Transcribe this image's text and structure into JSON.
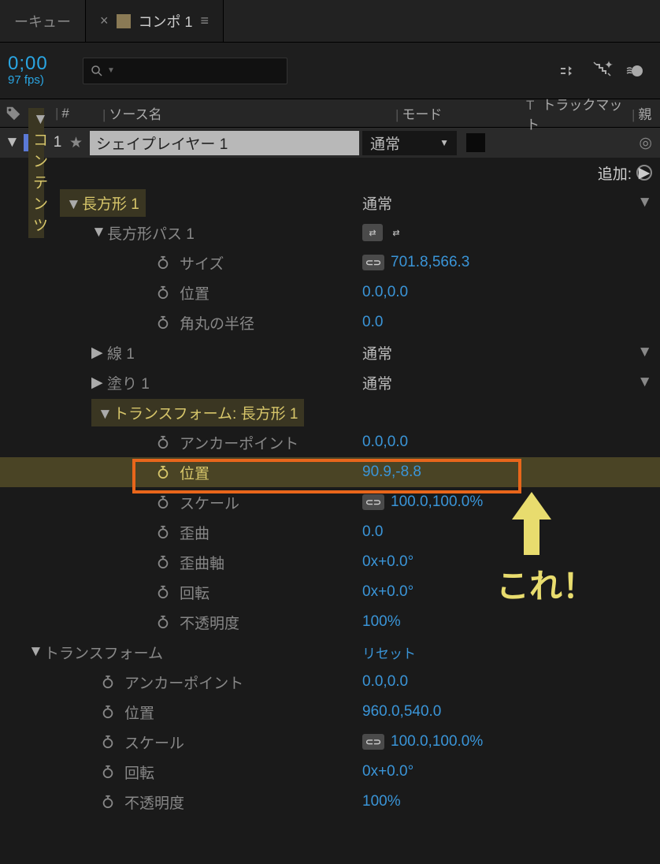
{
  "tabs": {
    "left": "ーキュー",
    "active": "コンポ 1"
  },
  "toolbar": {
    "time": "0;00",
    "fps": "97 fps)"
  },
  "cols": {
    "hash": "#",
    "source": "ソース名",
    "mode": "モード",
    "track": "トラックマット",
    "parent": "親",
    "t": "T"
  },
  "layer": {
    "num": "1",
    "name": "シェイプレイヤー 1",
    "mode": "通常"
  },
  "contents": {
    "label": "コンテンツ",
    "add": "追加:"
  },
  "rect": {
    "label": "長方形 1",
    "mode": "通常",
    "path": {
      "label": "長方形パス 1",
      "size_l": "サイズ",
      "size_v": "701.8,566.3",
      "pos_l": "位置",
      "pos_v": "0.0,0.0",
      "round_l": "角丸の半径",
      "round_v": "0.0"
    },
    "stroke": {
      "label": "線 1",
      "mode": "通常"
    },
    "fill": {
      "label": "塗り 1",
      "mode": "通常"
    },
    "xf": {
      "label": "トランスフォーム: 長方形 1",
      "anchor_l": "アンカーポイント",
      "anchor_v": "0.0,0.0",
      "pos_l": "位置",
      "pos_v": "90.9,-8.8",
      "scale_l": "スケール",
      "scale_v": "100.0,100.0%",
      "skew_l": "歪曲",
      "skew_v": "0.0",
      "skewax_l": "歪曲軸",
      "skewax_v": "0x+0.0°",
      "rot_l": "回転",
      "rot_v": "0x+0.0°",
      "opa_l": "不透明度",
      "opa_v": "100%"
    }
  },
  "xform": {
    "label": "トランスフォーム",
    "reset": "リセット",
    "anchor_l": "アンカーポイント",
    "anchor_v": "0.0,0.0",
    "pos_l": "位置",
    "pos_v": "960.0,540.0",
    "scale_l": "スケール",
    "scale_v": "100.0,100.0%",
    "rot_l": "回転",
    "rot_v": "0x+0.0°",
    "opa_l": "不透明度",
    "opa_v": "100%"
  },
  "callout": "これ！"
}
